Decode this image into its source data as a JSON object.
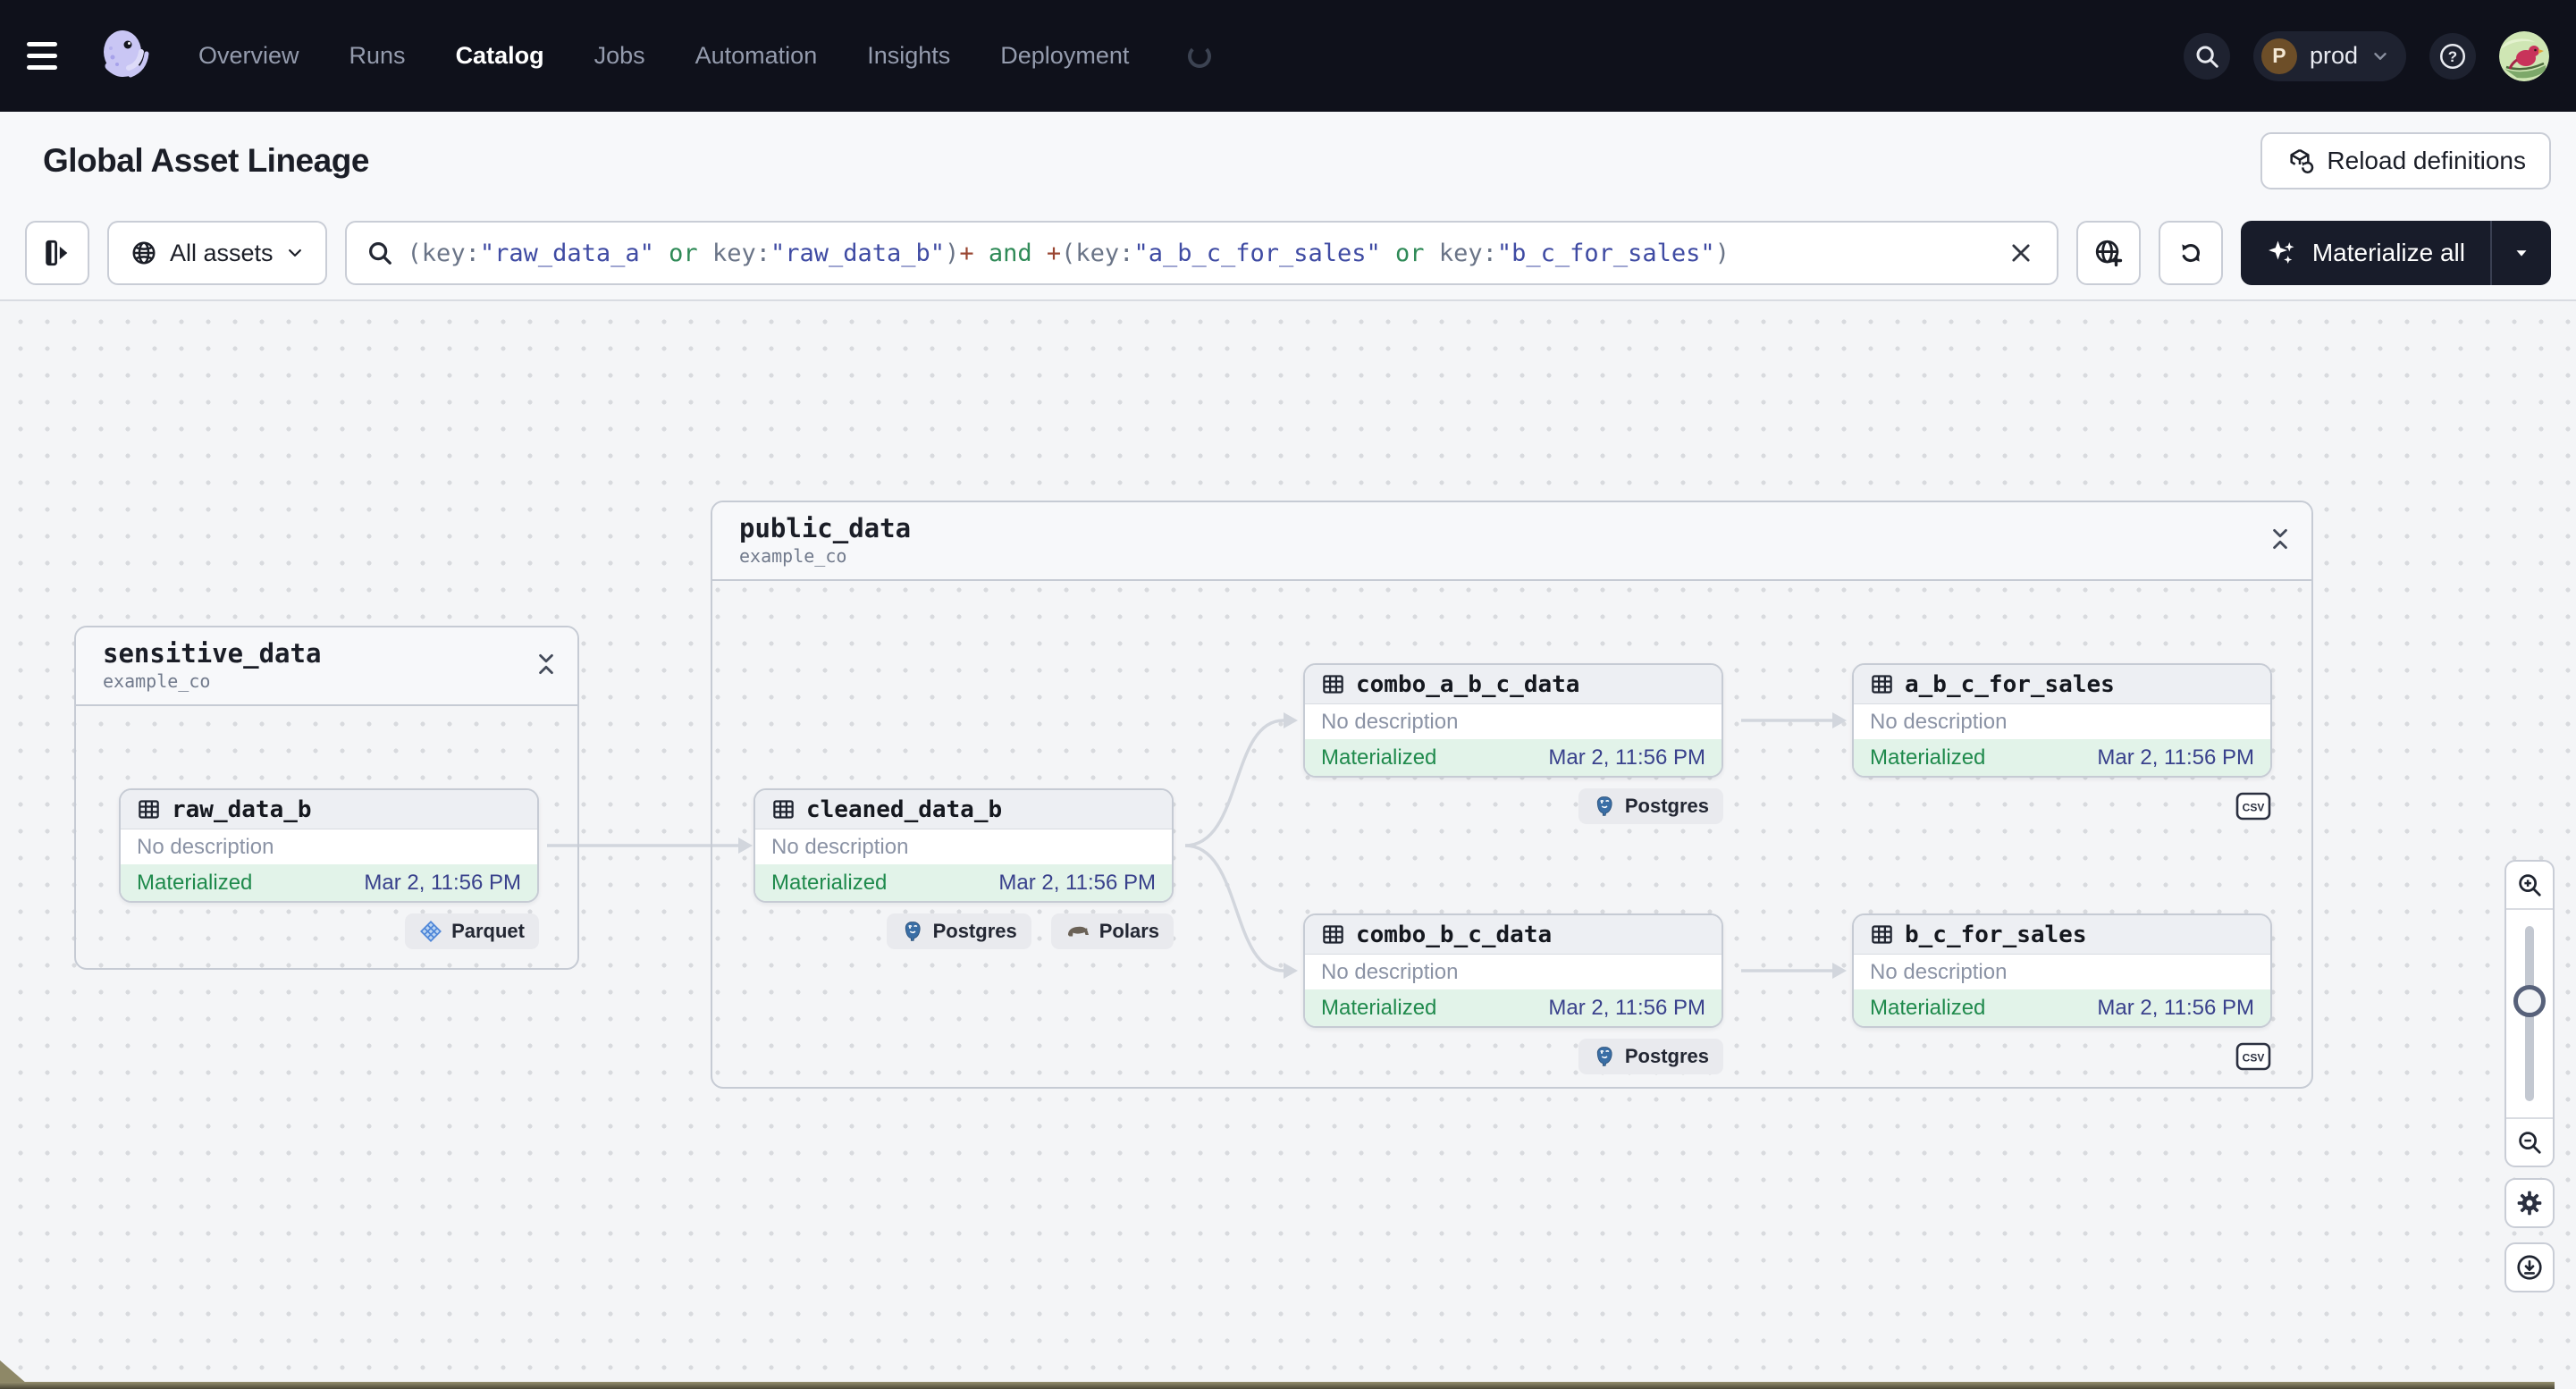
{
  "topnav": {
    "items": [
      {
        "label": "Overview",
        "active": false
      },
      {
        "label": "Runs",
        "active": false
      },
      {
        "label": "Catalog",
        "active": true
      },
      {
        "label": "Jobs",
        "active": false
      },
      {
        "label": "Automation",
        "active": false
      },
      {
        "label": "Insights",
        "active": false
      },
      {
        "label": "Deployment",
        "active": false
      }
    ],
    "env": {
      "initial": "P",
      "name": "prod"
    }
  },
  "header": {
    "title": "Global Asset Lineage",
    "reload_label": "Reload definitions"
  },
  "toolbar": {
    "scope_label": "All assets",
    "materialize_label": "Materialize all",
    "search": {
      "tokens": [
        {
          "t": "(key:",
          "c": "punct"
        },
        {
          "t": "\"raw_data_a\"",
          "c": "str"
        },
        {
          "t": " ",
          "c": "punct"
        },
        {
          "t": "or",
          "c": "op"
        },
        {
          "t": " key:",
          "c": "punct"
        },
        {
          "t": "\"raw_data_b\"",
          "c": "str"
        },
        {
          "t": ")",
          "c": "punct"
        },
        {
          "t": "+",
          "c": "plus"
        },
        {
          "t": " ",
          "c": "punct"
        },
        {
          "t": "and",
          "c": "op"
        },
        {
          "t": " ",
          "c": "punct"
        },
        {
          "t": "+",
          "c": "plus"
        },
        {
          "t": "(key:",
          "c": "punct"
        },
        {
          "t": "\"a_b_c_for_sales\"",
          "c": "str"
        },
        {
          "t": " ",
          "c": "punct"
        },
        {
          "t": "or",
          "c": "op"
        },
        {
          "t": " key:",
          "c": "punct"
        },
        {
          "t": "\"b_c_for_sales\"",
          "c": "str"
        },
        {
          "t": ")",
          "c": "punct"
        }
      ]
    }
  },
  "graph": {
    "groups": [
      {
        "title": "sensitive_data",
        "subtitle": "example_co"
      },
      {
        "title": "public_data",
        "subtitle": "example_co"
      }
    ],
    "nodes": [
      {
        "title": "raw_data_b",
        "description": "No description",
        "status": "Materialized",
        "timestamp": "Mar 2, 11:56 PM",
        "tags": [
          {
            "label": "Parquet"
          }
        ]
      },
      {
        "title": "cleaned_data_b",
        "description": "No description",
        "status": "Materialized",
        "timestamp": "Mar 2, 11:56 PM",
        "tags": [
          {
            "label": "Postgres"
          },
          {
            "label": "Polars"
          }
        ]
      },
      {
        "title": "combo_a_b_c_data",
        "description": "No description",
        "status": "Materialized",
        "timestamp": "Mar 2, 11:56 PM",
        "tags": [
          {
            "label": "Postgres"
          }
        ]
      },
      {
        "title": "a_b_c_for_sales",
        "description": "No description",
        "status": "Materialized",
        "timestamp": "Mar 2, 11:56 PM",
        "tags": [
          {
            "label": "CSV"
          }
        ]
      },
      {
        "title": "combo_b_c_data",
        "description": "No description",
        "status": "Materialized",
        "timestamp": "Mar 2, 11:56 PM",
        "tags": [
          {
            "label": "Postgres"
          }
        ]
      },
      {
        "title": "b_c_for_sales",
        "description": "No description",
        "status": "Materialized",
        "timestamp": "Mar 2, 11:56 PM",
        "tags": [
          {
            "label": "CSV"
          }
        ]
      }
    ]
  },
  "colors": {
    "nav_bg": "#0f111b",
    "materialized_green": "#1f8a4c",
    "status_row_bg": "#e2f3e9",
    "timestamp_navy": "#39418c",
    "query_string": "#3f4ba3",
    "query_operator": "#2f8a57",
    "query_plus": "#9a4632",
    "edge_gray": "#d2d6dd"
  }
}
